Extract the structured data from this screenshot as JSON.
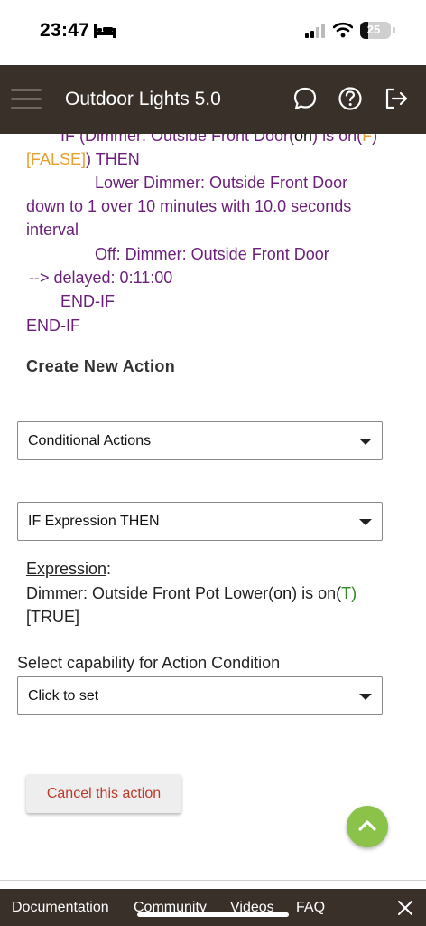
{
  "status_bar": {
    "time": "23:47",
    "battery": "25",
    "battery_level": 0.25
  },
  "header": {
    "title": "Outdoor Lights 5.0",
    "icons": [
      "menu-icon",
      "chat-bubble-icon",
      "help-icon",
      "logout-icon"
    ]
  },
  "rule_text": {
    "line1": {
      "prefix": "IF (Dimmer: Outside Front Door(",
      "state": "on",
      "middle": ") is on(",
      "flag": "F",
      "suffix": ")"
    },
    "line2": {
      "flag": "[FALSE]",
      "text": ") THEN"
    },
    "line3": "Lower Dimmer: Outside Front Door",
    "line4": "down to 1 over 10 minutes with 10.0 seconds",
    "line5": "interval",
    "line6": "Off: Dimmer: Outside Front Door",
    "line7": "--> delayed: 0:11:00",
    "line8": "END-IF",
    "line9": "END-IF"
  },
  "create_section": {
    "title": "Create New Action",
    "action_type_select": "Conditional Actions",
    "conditional_select": "IF Expression THEN",
    "expression_label": "Expression",
    "expression_colon": ":",
    "expression_line1_prefix": "Dimmer: Outside Front Pot Lower(",
    "expression_state": "on",
    "expression_line1_middle": ") is on(",
    "expression_flag": "T",
    "expression_line1_suffix": ")",
    "expression_line2": "[TRUE]",
    "capability_label": "Select capability for Action Condition",
    "capability_select": "Click to set",
    "cancel_button": "Cancel this action"
  },
  "footer": {
    "links": [
      "Documentation",
      "Community",
      "Videos",
      "FAQ"
    ]
  },
  "colors": {
    "header_bg": "#3a302a",
    "rule_purple": "#6b1f7a",
    "false_orange": "#e8a030",
    "true_green": "#2e8b22",
    "cancel_red": "#c0392b",
    "fab_green": "#8bc34a"
  }
}
